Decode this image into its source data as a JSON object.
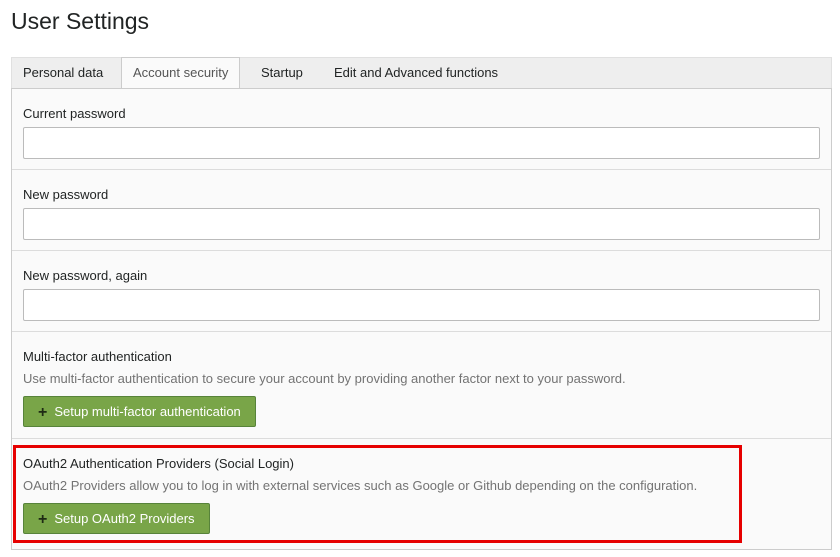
{
  "page": {
    "title": "User Settings"
  },
  "tabs": [
    {
      "label": "Personal data",
      "active": false
    },
    {
      "label": "Account security",
      "active": true
    },
    {
      "label": "Startup",
      "active": false
    },
    {
      "label": "Edit and Advanced functions",
      "active": false
    }
  ],
  "fields": {
    "current_password": {
      "label": "Current password",
      "value": ""
    },
    "new_password": {
      "label": "New password",
      "value": ""
    },
    "new_password_again": {
      "label": "New password, again",
      "value": ""
    }
  },
  "mfa": {
    "title": "Multi-factor authentication",
    "description": "Use multi-factor authentication to secure your account by providing another factor next to your password.",
    "button_label": "Setup multi-factor authentication"
  },
  "oauth": {
    "title": "OAuth2 Authentication Providers (Social Login)",
    "description": "OAuth2 Providers allow you to log in with external services such as Google or Github depending on the configuration.",
    "button_label": "Setup OAuth2 Providers"
  },
  "icons": {
    "button_icon": "plus-icon",
    "button_icon_glyph": "+"
  },
  "colors": {
    "button_green": "#79a548",
    "highlight_red": "#e60000",
    "tab_bar": "#eeeeee",
    "panel_bg": "#fafafa"
  }
}
